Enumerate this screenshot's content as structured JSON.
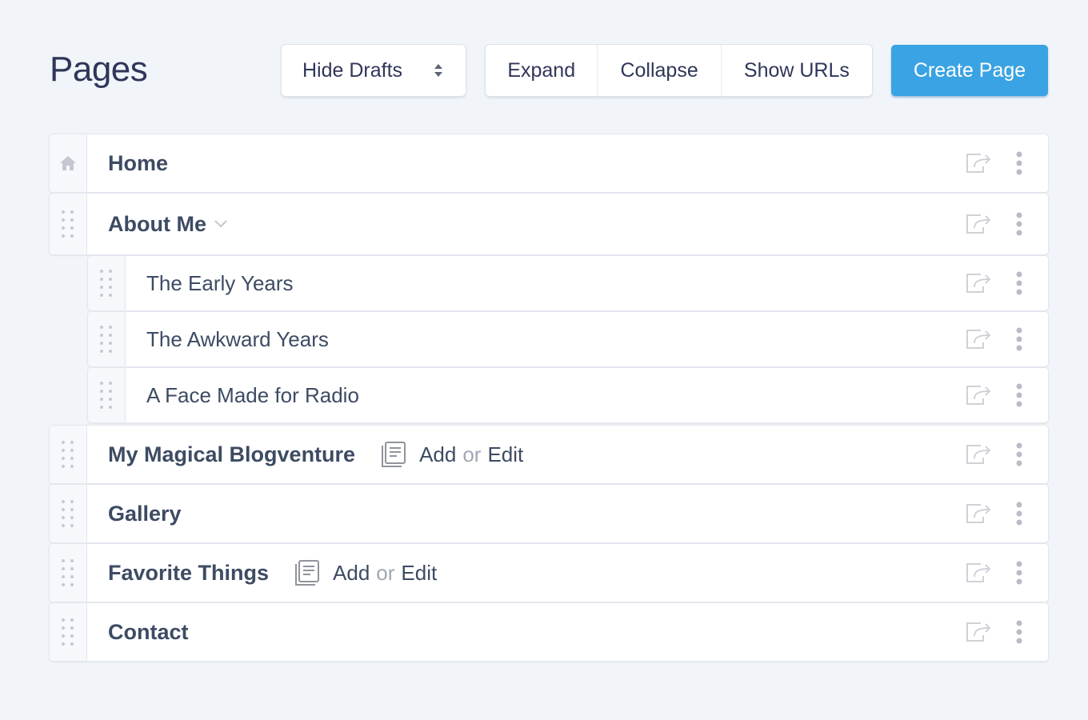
{
  "header": {
    "title": "Pages",
    "drafts_select": {
      "selected": "Hide Drafts"
    },
    "buttons": {
      "expand": "Expand",
      "collapse": "Collapse",
      "show_urls": "Show URLs",
      "create": "Create Page"
    }
  },
  "pages": [
    {
      "title": "Home",
      "level": 0,
      "icon": "home-icon"
    },
    {
      "title": "About Me",
      "level": 0,
      "icon": "drag-handle-icon",
      "expanded": true
    },
    {
      "title": "The Early Years",
      "level": 1,
      "icon": "drag-handle-icon"
    },
    {
      "title": "The Awkward Years",
      "level": 1,
      "icon": "drag-handle-icon"
    },
    {
      "title": "A Face Made for Radio",
      "level": 1,
      "icon": "drag-handle-icon"
    },
    {
      "title": "My Magical Blogventure",
      "level": 0,
      "icon": "drag-handle-icon",
      "entries": {
        "add": "Add",
        "or": "or",
        "edit": "Edit"
      }
    },
    {
      "title": "Gallery",
      "level": 0,
      "icon": "drag-handle-icon"
    },
    {
      "title": "Favorite Things",
      "level": 0,
      "icon": "drag-handle-icon",
      "entries": {
        "add": "Add",
        "or": "or",
        "edit": "Edit"
      }
    },
    {
      "title": "Contact",
      "level": 0,
      "icon": "drag-handle-icon"
    }
  ],
  "colors": {
    "accent": "#3aa3e3",
    "background": "#f1f4f9",
    "text": "#3d4b63"
  }
}
